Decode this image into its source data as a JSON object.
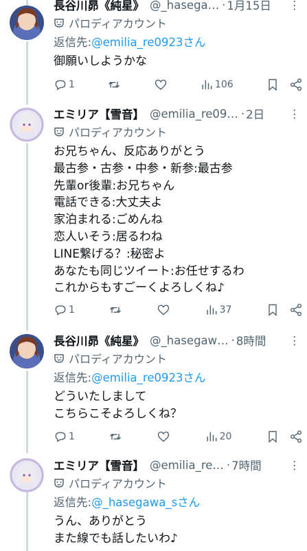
{
  "parody_label": "パロディアカウント",
  "tweets": [
    {
      "name": "長谷川昴《純星》",
      "handle": "@_hasega…",
      "time": "1月15日",
      "more": "⋮",
      "reply_prefix": "返信先:",
      "reply_mention": "@emilia_re0923さん",
      "reply_suffix": "",
      "body": [
        "御願いしようかな"
      ],
      "replies": "1",
      "retweets": "",
      "likes": "",
      "views": "106"
    },
    {
      "name": "エミリア【雪音】",
      "handle": "@emilia_re09…",
      "time": "2日",
      "more": "⋮",
      "body": [
        "お兄ちゃん、反応ありがとう",
        "最古参・古参・中参・新参:最古参",
        "先輩or後輩:お兄ちゃん",
        "電話できる:大丈夫よ",
        "家泊まれる:ごめんね",
        "恋人いそう:居るわね",
        "LINE繋げる？:秘密よ",
        "あなたも同じツイート:お任せするわ",
        "これからもすごーくよろしくね♪"
      ],
      "replies": "1",
      "retweets": "",
      "likes": "",
      "views": "37"
    },
    {
      "name": "長谷川昴《純星》",
      "handle": "@_hasegaw…",
      "time": "8時間",
      "more": "⋮",
      "reply_prefix": "返信先:",
      "reply_mention": "@emilia_re0923さん",
      "body": [
        "どういたしまして",
        "こちらこそよろしくね？"
      ],
      "replies": "1",
      "retweets": "",
      "likes": "",
      "views": "20"
    },
    {
      "name": "エミリア【雪音】",
      "handle": "@emilia_re…",
      "time": "7時間",
      "more": "⋮",
      "reply_prefix": "返信先:",
      "reply_mention": "@_hasegawa_sさん",
      "body": [
        "うん、ありがとう",
        "また線でも話したいわ♪"
      ]
    }
  ],
  "colors": {
    "link": "#1d9bf0",
    "secondary": "#536471",
    "text": "#0f1419",
    "thread": "#cfd9de"
  }
}
